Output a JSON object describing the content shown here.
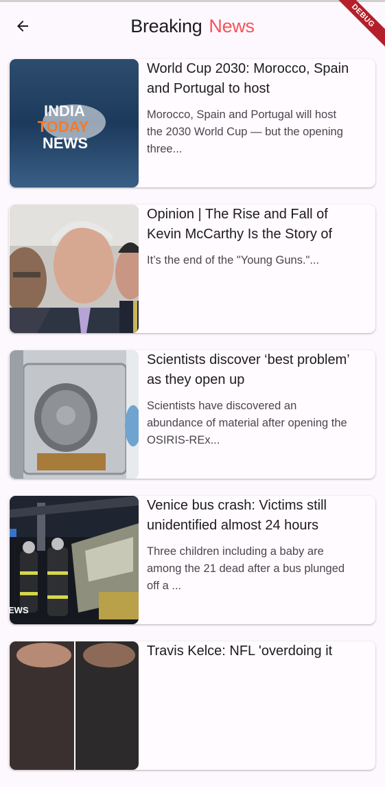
{
  "appbar": {
    "title_part1": "Breaking",
    "title_part2": "News",
    "title_accent_color": "#f2545b",
    "back_icon": "arrow-back-icon",
    "debug_banner": "DEBUG"
  },
  "articles": [
    {
      "title": "World Cup 2030: Morocco, Spain and Portugal to host",
      "description": "Morocco, Spain and Portugal will host the 2030 World Cup — but the opening three...",
      "thumbnail": "india-today-news-logo",
      "logo_text": [
        "INDIA",
        "TODAY",
        "NEWS"
      ]
    },
    {
      "title": "Opinion | The Rise and Fall of Kevin McCarthy Is the Story of",
      "description": " It’s the end of the \"Young Guns.\"...",
      "thumbnail": "photo-men-in-suits"
    },
    {
      "title": "Scientists discover ‘best problem’ as they open up",
      "description": "Scientists have discovered an abundance of material after opening the OSIRIS-REx...",
      "thumbnail": "photo-sample-capsule"
    },
    {
      "title": "Venice bus crash: Victims still unidentified almost 24 hours",
      "description": "Three children including a baby are among the 21 dead after a bus plunged off a ...",
      "thumbnail": "photo-night-rescue",
      "overlay_text": "EWS"
    },
    {
      "title": "Travis Kelce: NFL 'overdoing it",
      "description": "",
      "thumbnail": "photo-partial"
    }
  ]
}
